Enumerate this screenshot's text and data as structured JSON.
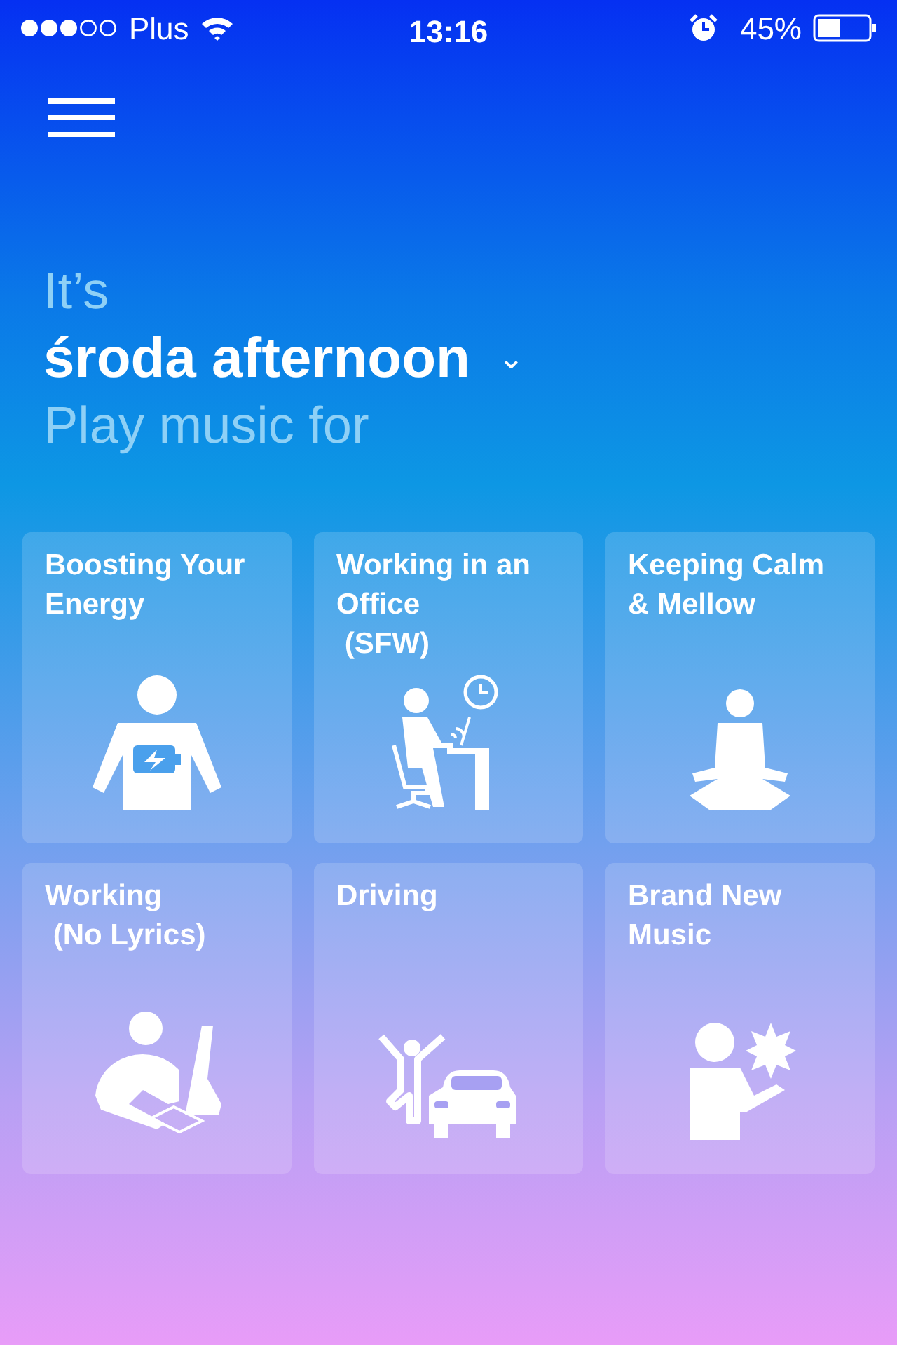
{
  "status_bar": {
    "carrier": "Plus",
    "time": "13:16",
    "battery": "45%"
  },
  "greeting": {
    "intro": "It’s",
    "day": "środa afternoon",
    "caret": "⌄",
    "prompt": "Play music for"
  },
  "tiles": [
    {
      "lines": [
        "Boosting Your",
        "Energy"
      ],
      "kind": "energy"
    },
    {
      "lines": [
        "Working in an",
        "Office",
        " (SFW)"
      ],
      "kind": "office"
    },
    {
      "lines": [
        "Keeping Calm",
        "& Mellow"
      ],
      "kind": "calm"
    },
    {
      "lines": [
        "Working",
        " (No Lyrics)"
      ],
      "kind": "focus"
    },
    {
      "lines": [
        "Driving"
      ],
      "kind": "driving"
    },
    {
      "lines": [
        "Brand New",
        "Music"
      ],
      "kind": "new"
    }
  ]
}
